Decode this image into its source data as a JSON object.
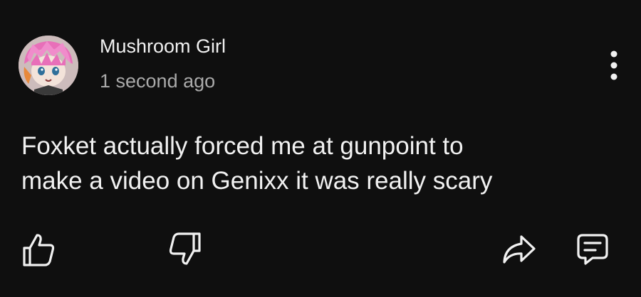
{
  "comment": {
    "author": "Mushroom Girl",
    "timestamp": "1 second ago",
    "text_lines": [
      "Foxket actually forced me at gunpoint to",
      "make a video on Genixx it was really scary"
    ]
  },
  "icons": {
    "avatar": "anime-pink-hair-avatar",
    "more": "more-vertical-icon",
    "like": "thumbs-up-icon",
    "dislike": "thumbs-down-icon",
    "share": "share-arrow-icon",
    "reply": "reply-comment-icon"
  },
  "colors": {
    "background": "#0f0f0f",
    "primary_text": "#f1f1f1",
    "secondary_text": "#aaaaaa",
    "icon": "#f1f1f1"
  }
}
